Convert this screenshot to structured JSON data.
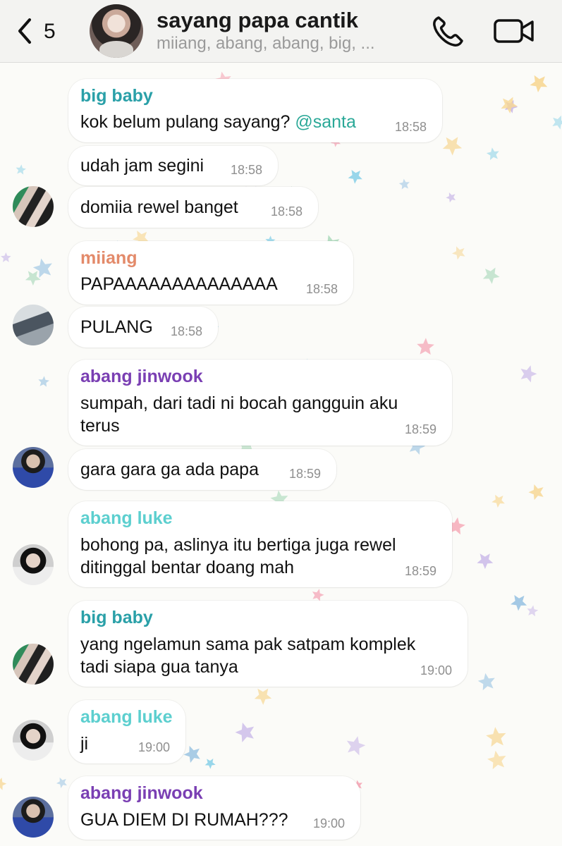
{
  "header": {
    "back_count": "5",
    "title": "sayang papa cantik",
    "subtitle": "miiang, abang, abang, big, ..."
  },
  "messages": [
    {
      "sender": "big baby",
      "sender_color": "#2aa0a8",
      "text": "kok belum pulang sayang? ",
      "mention": "@santa",
      "time": "18:58"
    },
    {
      "text": "udah jam segini",
      "time": "18:58"
    },
    {
      "text": "domiia rewel banget",
      "time": "18:58"
    },
    {
      "sender": "miiang",
      "sender_color": "#e38a6a",
      "text": "PAPAAAAAAAAAAAAAA",
      "time": "18:58"
    },
    {
      "text": "PULANG",
      "time": "18:58"
    },
    {
      "sender": "abang jinwook",
      "sender_color": "#7a3fb3",
      "text_lines": [
        "sumpah, dari tadi ni bocah gangguin aku",
        "terus"
      ],
      "time": "18:59"
    },
    {
      "text": "gara gara ga ada papa",
      "time": "18:59"
    },
    {
      "sender": "abang luke",
      "sender_color": "#5ccfcf",
      "text_lines": [
        "bohong pa, aslinya itu bertiga juga rewel",
        "ditinggal bentar doang mah"
      ],
      "time": "18:59"
    },
    {
      "sender": "big baby",
      "sender_color": "#2aa0a8",
      "text_lines": [
        "yang ngelamun sama pak satpam komplek",
        "tadi siapa gua tanya"
      ],
      "time": "19:00"
    },
    {
      "sender": "abang luke",
      "sender_color": "#5ccfcf",
      "text": "ji",
      "time": "19:00"
    },
    {
      "sender": "abang jinwook",
      "sender_color": "#7a3fb3",
      "text": "GUA DIEM DI RUMAH???",
      "time": "19:00"
    }
  ],
  "icons": {
    "back": "chevron-left-icon",
    "call": "phone-icon",
    "video": "video-camera-icon"
  },
  "colors": {
    "header_bg": "#f3f3f1",
    "bubble_bg": "#ffffff",
    "mention": "#2aa897"
  }
}
